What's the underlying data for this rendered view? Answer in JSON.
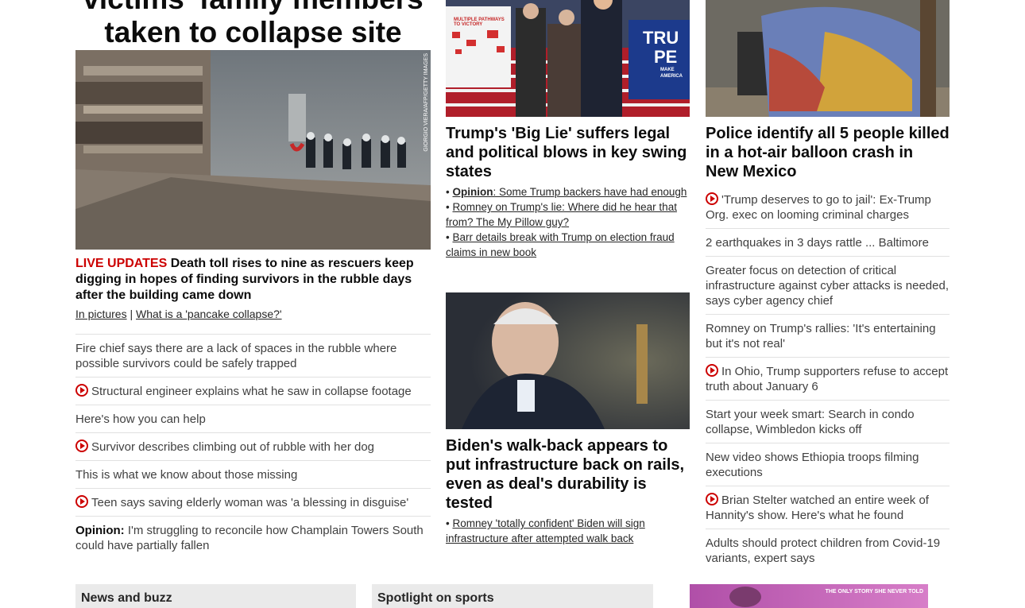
{
  "col1": {
    "headline_line1": "victims' family members",
    "headline_line2": "taken to collapse site",
    "photo_credit": "GIORGIO VIERA/AFP/GETTY IMAGES",
    "live_label": "LIVE UPDATES",
    "lead_text": " Death toll rises to nine as rescuers keep digging in hopes of finding survivors in the rubble days after the building came down",
    "sublink1": "In pictures",
    "separator": "|",
    "sublink2": "What is a 'pancake collapse?'",
    "items": [
      {
        "text": "Fire chief says there are a lack of spaces in the rubble where possible survivors could be safely trapped"
      },
      {
        "text": "Structural engineer explains what he saw in collapse footage"
      },
      {
        "text": "Here's how you can help"
      },
      {
        "text": "Survivor describes climbing out of rubble with her dog"
      },
      {
        "text": "This is what we know about those missing"
      },
      {
        "text": "Teen says saving elderly woman was 'a blessing in disguise'"
      },
      {
        "prefix": "Opinion:",
        "text": " I'm struggling to reconcile how Champlain Towers South could have partially fallen"
      }
    ]
  },
  "col2": {
    "photo1_map_title": "MULTIPLE PATHWAYS TO VICTORY",
    "photo1_sign_line1": "TRU",
    "photo1_sign_line2": "PE",
    "photo1_sign_line3": "MAKE AMERICA",
    "headline1": "Trump's 'Big Lie' suffers legal and political blows in key swing states",
    "bullet1_bold": "Opinion",
    "bullet1_text": ": Some Trump backers have had enough",
    "bullet2_text": "Romney on Trump's lie: Where did he hear that from? The My Pillow guy?",
    "bullet3_text": "Barr details break with Trump on election fraud claims in new book",
    "headline2": "Biden's walk-back appears to put infrastructure back on rails, even as deal's durability is tested",
    "bullet4_text": "Romney 'totally confident' Biden will sign infrastructure after attempted walk back"
  },
  "col3": {
    "headline": "Police identify all 5 people killed in a hot-air balloon crash in New Mexico",
    "items": [
      {
        "text": "'Trump deserves to go to jail': Ex-Trump Org. exec on looming criminal charges"
      },
      {
        "text": "2 earthquakes in 3 days rattle ... Baltimore"
      },
      {
        "text": "Greater focus on detection of critical infrastructure against cyber attacks is needed, says cyber agency chief"
      },
      {
        "text": "Romney on Trump's rallies: 'It's entertaining but it's not real'"
      },
      {
        "text": "In Ohio, Trump supporters refuse to accept truth about January 6"
      },
      {
        "text": "Start your week smart: Search in condo collapse, Wimbledon kicks off"
      },
      {
        "text": "New video shows Ethiopia troops filming executions"
      },
      {
        "text": "Brian Stelter watched an entire week of Hannity's show. Here's what he found"
      },
      {
        "text": "Adults should protect children from Covid-19 variants, expert says"
      }
    ]
  },
  "bottom": {
    "box1": "News and buzz",
    "box2": "Spotlight on sports",
    "ad_text": "THE ONLY STORY SHE NEVER TOLD"
  }
}
